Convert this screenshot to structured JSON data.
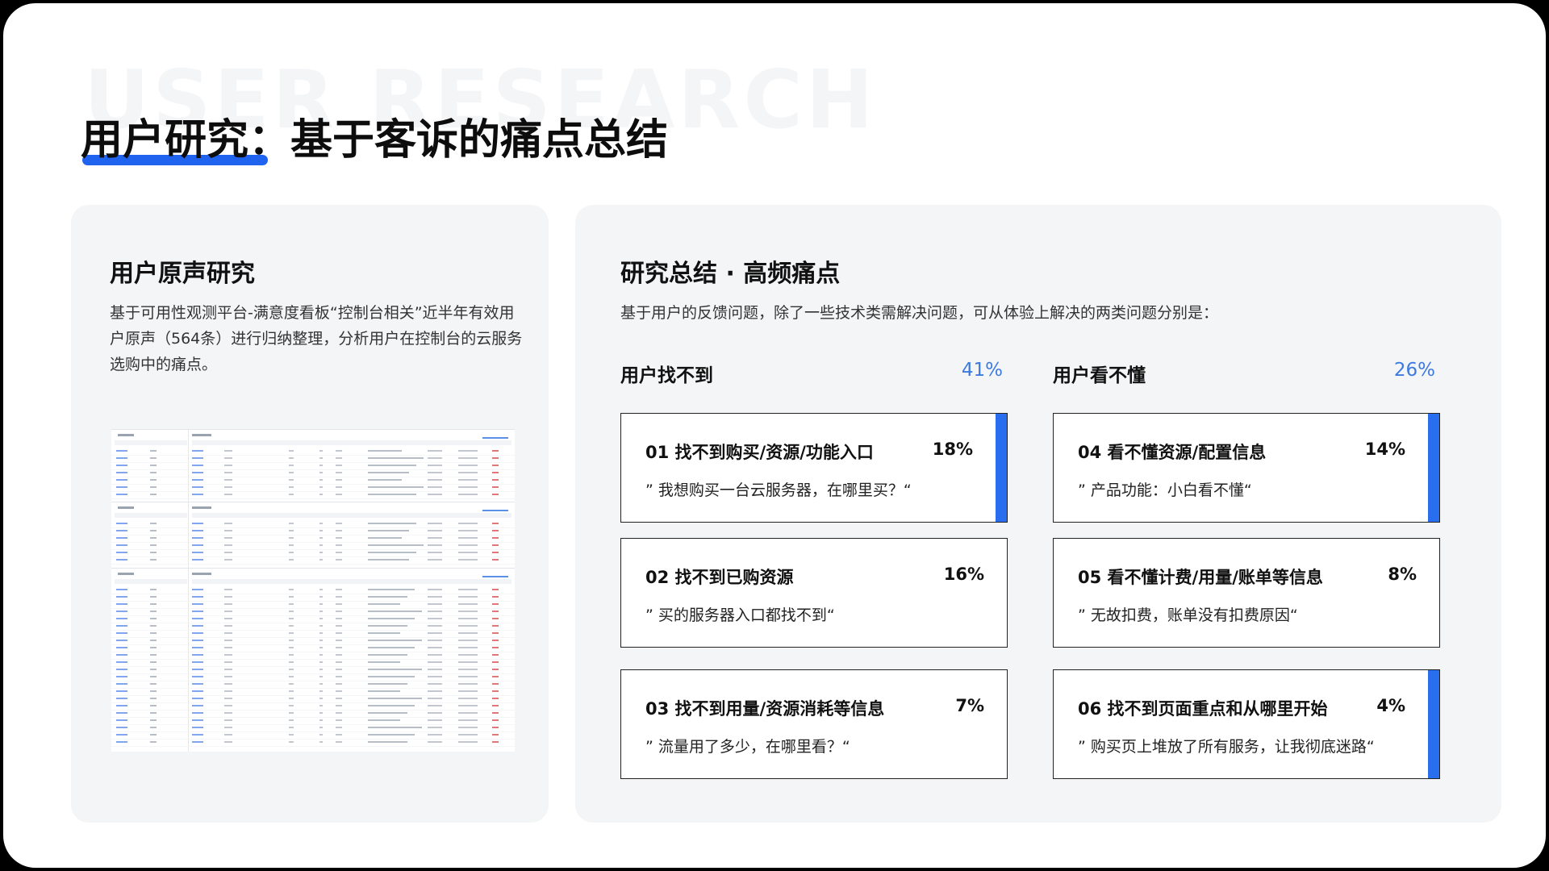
{
  "watermark": "USER RESEARCH",
  "page_title": "用户研究：基于客诉的痛点总结",
  "left_panel": {
    "title": "用户原声研究",
    "description": "基于可用性观测平台-满意度看板“控制台相关”近半年有效用户原声（564条）进行归纳整理，分析用户在控制台的云服务选购中的痛点。"
  },
  "right_panel": {
    "title": "研究总结 · 高频痛点",
    "description": "基于用户的反馈问题，除了一些技术类需解决问题，可从体验上解决的两类问题分别是：",
    "groups": [
      {
        "label": "用户找不到",
        "percent": "41%",
        "cards": [
          {
            "title": "01 找不到购买/资源/功能入口",
            "percent": "18%",
            "quote": "” 我想购买一台云服务器，在哪里买？“"
          },
          {
            "title": "02 找不到已购资源",
            "percent": "16%",
            "quote": "” 买的服务器入口都找不到“"
          },
          {
            "title": "03 找不到用量/资源消耗等信息",
            "percent": "7%",
            "quote": "” 流量用了多少，在哪里看？“"
          }
        ]
      },
      {
        "label": "用户看不懂",
        "percent": "26%",
        "cards": [
          {
            "title": "04 看不懂资源/配置信息",
            "percent": "14%",
            "quote": "” 产品功能：小白看不懂“"
          },
          {
            "title": "05 看不懂计费/用量/账单等信息",
            "percent": "8%",
            "quote": "” 无故扣费，账单没有扣费原因“"
          },
          {
            "title": "06 找不到页面重点和从哪里开始",
            "percent": "4%",
            "quote": "” 购买页上堆放了所有服务，让我彻底迷路“"
          }
        ]
      }
    ]
  },
  "colors": {
    "accent": "#2a6ef0",
    "percent": "#3d7adf",
    "panel_bg": "#f4f5f7"
  }
}
